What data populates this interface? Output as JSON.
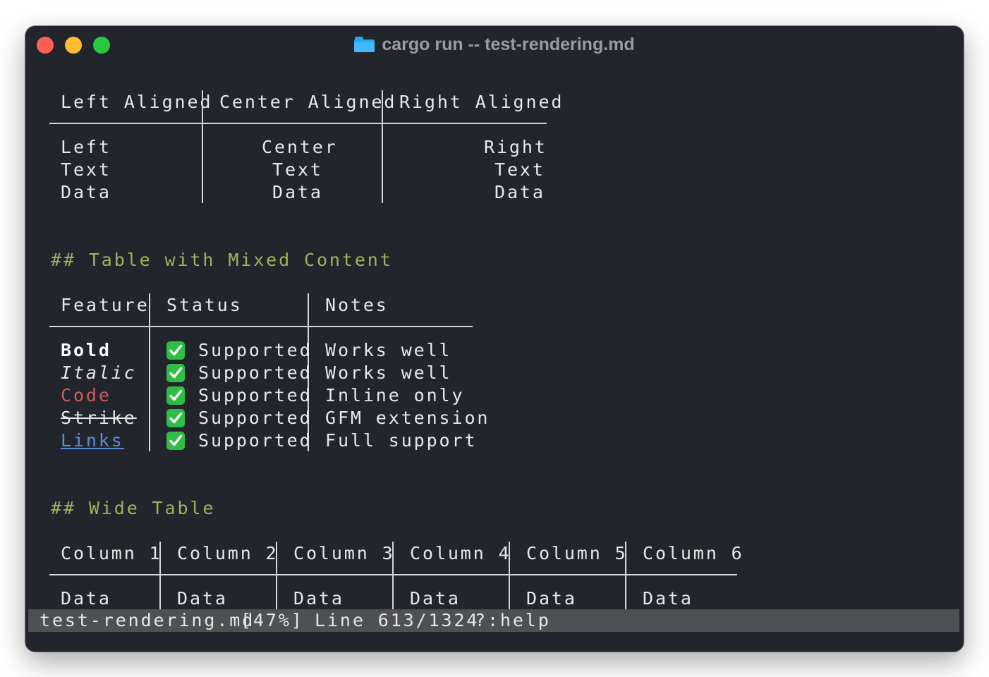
{
  "window": {
    "title": "cargo run -- test-rendering.md",
    "title_icon": "folder-icon"
  },
  "table1": {
    "headers": [
      "Left Aligned",
      "Center Aligned",
      "Right Aligned"
    ],
    "rows": [
      [
        "Left",
        "Center",
        "Right"
      ],
      [
        "Text",
        "Text",
        "Text"
      ],
      [
        "Data",
        "Data",
        "Data"
      ]
    ]
  },
  "heading_mixed": "## Table with Mixed Content",
  "table2": {
    "headers": [
      "Feature",
      "Status",
      "Notes"
    ],
    "rows": [
      {
        "feature": "Bold",
        "status": "Supported",
        "notes": "Works well"
      },
      {
        "feature": "Italic",
        "status": "Supported",
        "notes": "Works well"
      },
      {
        "feature": "Code",
        "status": "Supported",
        "notes": "Inline only"
      },
      {
        "feature": "Strike",
        "status": "Supported",
        "notes": "GFM extension"
      },
      {
        "feature": "Links",
        "status": "Supported",
        "notes": "Full support"
      }
    ],
    "status_icon": "check-icon"
  },
  "heading_wide": "## Wide Table",
  "table3": {
    "headers": [
      "Column 1",
      "Column 2",
      "Column 3",
      "Column 4",
      "Column 5",
      "Column 6"
    ],
    "rows": [
      [
        "Data",
        "Data",
        "Data",
        "Data",
        "Data",
        "Data"
      ]
    ]
  },
  "statusbar": {
    "filename": "test-rendering.md",
    "percent": "[47%]",
    "line": "Line 613/1324",
    "help": "?:help"
  },
  "colors": {
    "background": "#22252c",
    "heading": "#a4b15b",
    "code": "#cb5b5b",
    "link": "#5f8ed6",
    "check": "#2fbd45",
    "statusbar": "#4f5053"
  }
}
